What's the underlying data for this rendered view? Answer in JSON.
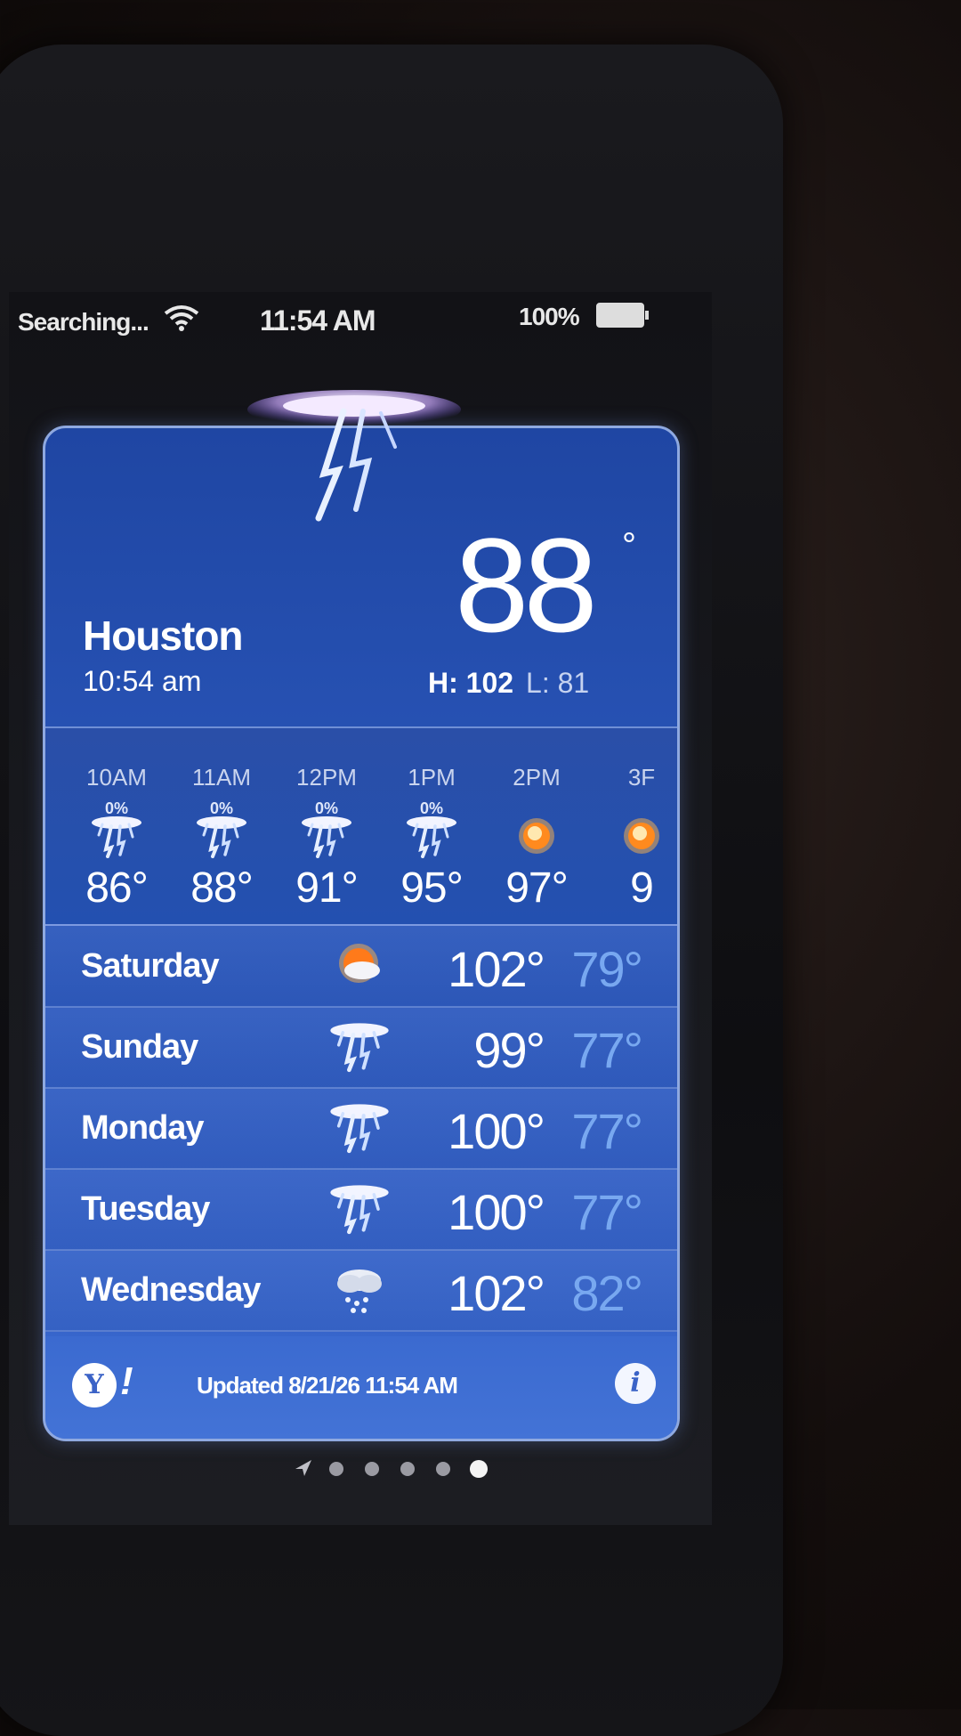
{
  "status_bar": {
    "carrier": "Searching...",
    "time": "11:54 AM",
    "battery": "100%"
  },
  "weather": {
    "city": "Houston",
    "local_time": "10:54 am",
    "current_temp": "88",
    "degree_symbol": "°",
    "high": "H: 102",
    "low": "L: 81",
    "hourly": [
      {
        "time": "10AM",
        "precip": "0%",
        "icon": "thunderstorm-icon",
        "temp": "86°"
      },
      {
        "time": "11AM",
        "precip": "0%",
        "icon": "thunderstorm-icon",
        "temp": "88°"
      },
      {
        "time": "12PM",
        "precip": "0%",
        "icon": "thunderstorm-icon",
        "temp": "91°"
      },
      {
        "time": "1PM",
        "precip": "0%",
        "icon": "thunderstorm-icon",
        "temp": "95°"
      },
      {
        "time": "2PM",
        "precip": "",
        "icon": "sun-icon",
        "temp": "97°"
      },
      {
        "time": "3F",
        "precip": "",
        "icon": "sun-icon",
        "temp": "9"
      }
    ],
    "daily": [
      {
        "day": "Saturday",
        "icon": "partly-sunny-icon",
        "high": "102°",
        "low": "79°"
      },
      {
        "day": "Sunday",
        "icon": "thunderstorm-icon",
        "high": "99°",
        "low": "77°"
      },
      {
        "day": "Monday",
        "icon": "thunderstorm-icon",
        "high": "100°",
        "low": "77°"
      },
      {
        "day": "Tuesday",
        "icon": "thunderstorm-icon",
        "high": "100°",
        "low": "77°"
      },
      {
        "day": "Wednesday",
        "icon": "rain-cloud-icon",
        "high": "102°",
        "low": "82°"
      }
    ],
    "updated": "Updated 8/21/26 11:54 AM",
    "yahoo_logo": "Y!",
    "info_glyph": "i"
  },
  "pager": {
    "pages": 5,
    "active": 5
  },
  "colors": {
    "card_blue": "#2955b8",
    "low_temp_blue": "#78a8f0",
    "accent": "#8fa9e0"
  }
}
